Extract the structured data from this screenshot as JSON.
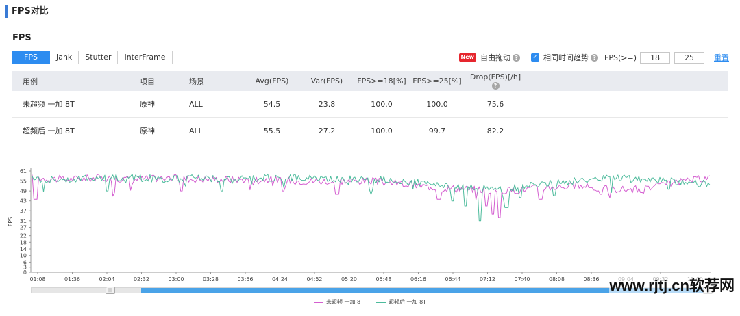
{
  "page_title": "FPS对比",
  "section_title": "FPS",
  "tabs": [
    {
      "label": "FPS",
      "active": true
    },
    {
      "label": "Jank",
      "active": false
    },
    {
      "label": "Stutter",
      "active": false
    },
    {
      "label": "InterFrame",
      "active": false
    }
  ],
  "toolbar": {
    "new_badge": "New",
    "free_drag_label": "自由拖动",
    "same_time_trend_label": "相同时间趋势",
    "same_time_trend_checked": true,
    "fps_threshold_label": "FPS(>=)",
    "threshold_1": "18",
    "threshold_2": "25",
    "reset_label": "重置"
  },
  "table": {
    "headers": [
      "用例",
      "项目",
      "场景",
      "Avg(FPS)",
      "Var(FPS)",
      "FPS>=18[%]",
      "FPS>=25[%]",
      "Drop(FPS)[/h]"
    ],
    "rows": [
      [
        "未超频 一加 8T",
        "原神",
        "ALL",
        "54.5",
        "23.8",
        "100.0",
        "100.0",
        "75.6"
      ],
      [
        "超频后 一加 8T",
        "原神",
        "ALL",
        "55.5",
        "27.2",
        "100.0",
        "99.7",
        "82.2"
      ]
    ]
  },
  "chart_data": {
    "type": "line",
    "ylabel": "FPS",
    "ylim": [
      0,
      61
    ],
    "yticks": [
      "0",
      "3",
      "6",
      "10",
      "14",
      "18",
      "22",
      "27",
      "31",
      "37",
      "43",
      "49",
      "55",
      "61"
    ],
    "xticks": [
      "01:08",
      "01:36",
      "02:04",
      "02:32",
      "03:00",
      "03:28",
      "03:56",
      "04:24",
      "04:52",
      "05:20",
      "05:48",
      "06:16",
      "06:44",
      "07:12",
      "07:40",
      "08:08",
      "08:36",
      "09:04",
      "09:32",
      "10:00"
    ],
    "series": [
      {
        "name": "未超频 一加 8T",
        "color": "#d45ed0",
        "anchors": [
          [
            0,
            57
          ],
          [
            0.05,
            56
          ],
          [
            0.1,
            57
          ],
          [
            0.15,
            56
          ],
          [
            0.2,
            57
          ],
          [
            0.25,
            56
          ],
          [
            0.3,
            56
          ],
          [
            0.35,
            56
          ],
          [
            0.4,
            55
          ],
          [
            0.45,
            55
          ],
          [
            0.5,
            55
          ],
          [
            0.55,
            53
          ],
          [
            0.6,
            51
          ],
          [
            0.65,
            50
          ],
          [
            0.7,
            49
          ],
          [
            0.75,
            51
          ],
          [
            0.8,
            52
          ],
          [
            0.85,
            50
          ],
          [
            0.9,
            50
          ],
          [
            0.95,
            54
          ],
          [
            1,
            57
          ]
        ],
        "dips": [
          [
            0.005,
            44
          ],
          [
            0.12,
            48
          ],
          [
            0.22,
            49
          ],
          [
            0.37,
            49
          ],
          [
            0.45,
            47
          ],
          [
            0.6,
            44
          ],
          [
            0.67,
            40
          ],
          [
            0.68,
            35
          ],
          [
            0.69,
            33
          ],
          [
            0.75,
            44
          ],
          [
            0.84,
            47
          ],
          [
            0.9,
            48
          ]
        ]
      },
      {
        "name": "超频后 一加 8T",
        "color": "#4dbb9c",
        "anchors": [
          [
            0,
            56
          ],
          [
            0.05,
            56
          ],
          [
            0.1,
            57
          ],
          [
            0.15,
            57
          ],
          [
            0.2,
            56
          ],
          [
            0.25,
            57
          ],
          [
            0.3,
            56
          ],
          [
            0.35,
            57
          ],
          [
            0.4,
            57
          ],
          [
            0.45,
            56
          ],
          [
            0.5,
            56
          ],
          [
            0.55,
            55
          ],
          [
            0.6,
            52
          ],
          [
            0.65,
            51
          ],
          [
            0.7,
            50
          ],
          [
            0.75,
            53
          ],
          [
            0.8,
            55
          ],
          [
            0.85,
            57
          ],
          [
            0.9,
            56
          ],
          [
            0.95,
            55
          ],
          [
            1,
            53
          ]
        ],
        "dips": [
          [
            0.11,
            49
          ],
          [
            0.28,
            49
          ],
          [
            0.5,
            50
          ],
          [
            0.62,
            43
          ],
          [
            0.64,
            40
          ],
          [
            0.66,
            31
          ],
          [
            0.7,
            39
          ],
          [
            0.72,
            45
          ],
          [
            0.77,
            46
          ],
          [
            0.94,
            50
          ]
        ]
      }
    ]
  },
  "legend": [
    {
      "label": "未超频 一加 8T",
      "color": "#d45ed0"
    },
    {
      "label": "超频后 一加 8T",
      "color": "#4dbb9c"
    }
  ],
  "watermark": "www.rjtj.cn软荐网"
}
